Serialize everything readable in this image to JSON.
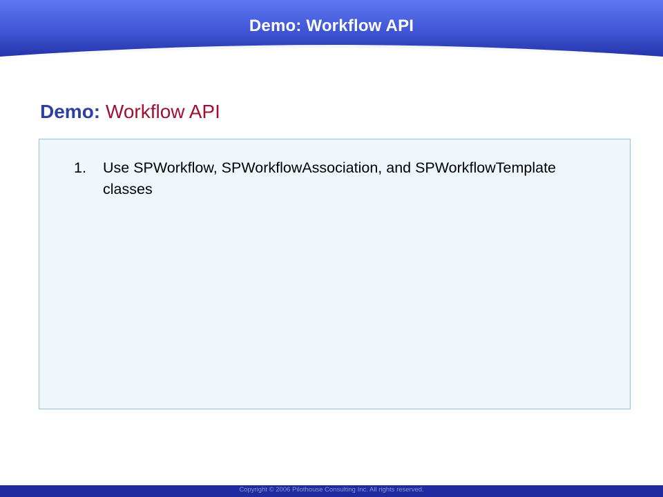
{
  "header": {
    "title": "Demo:  Workflow API"
  },
  "slide_title": {
    "prefix": "Demo:",
    "rest": "Workflow API"
  },
  "content": {
    "items": [
      {
        "number": "1.",
        "text": "Use SPWorkflow, SPWorkflowAssociation, and SPWorkflowTemplate classes"
      }
    ]
  },
  "footer": {
    "copyright": "Copyright © 2006 Pilothouse Consulting Inc. All rights reserved."
  },
  "colors": {
    "header_blue": "#3f55d6",
    "header_dark": "#2534a8",
    "title_blue": "#2e3f9e",
    "title_red": "#a01030",
    "box_fill": "#eff7fd",
    "box_border": "#8fc3e4",
    "footer_blue": "#1f2b9e"
  }
}
